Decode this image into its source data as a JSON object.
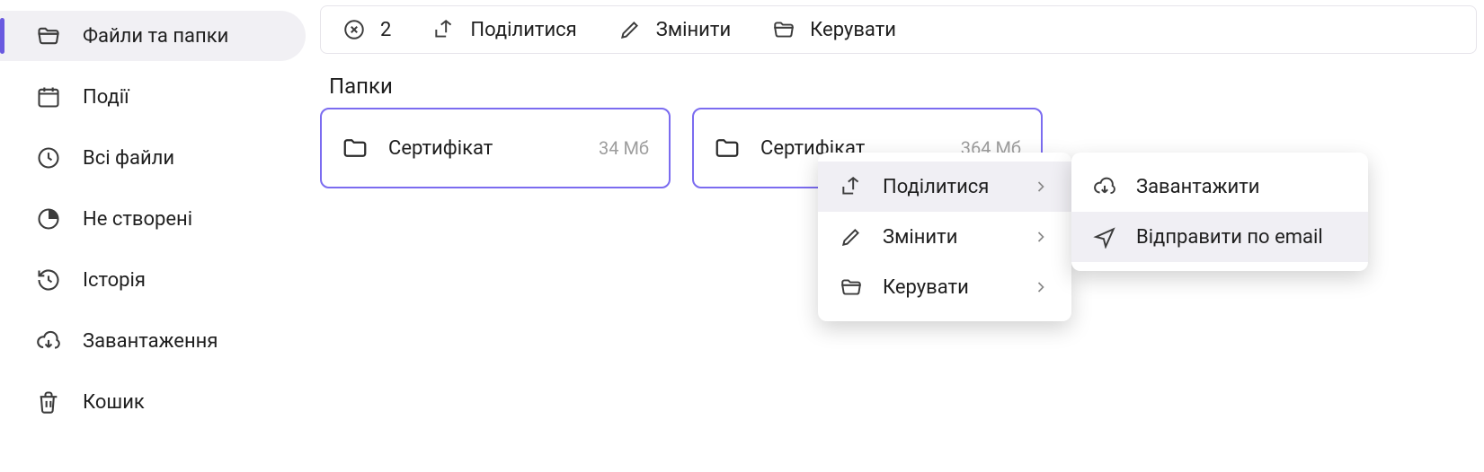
{
  "sidebar": {
    "items": [
      {
        "label": "Файли та папки",
        "icon": "folder-open"
      },
      {
        "label": "Події",
        "icon": "calendar"
      },
      {
        "label": "Всі файли",
        "icon": "clock"
      },
      {
        "label": "Не створені",
        "icon": "progress"
      },
      {
        "label": "Історія",
        "icon": "history"
      },
      {
        "label": "Завантаження",
        "icon": "download-cloud"
      },
      {
        "label": "Кошик",
        "icon": "trash"
      }
    ]
  },
  "toolbar": {
    "count": "2",
    "share": "Поділитися",
    "edit": "Змінити",
    "manage": "Керувати"
  },
  "section_title": "Папки",
  "folders": [
    {
      "name": "Сертифікат",
      "size": "34 Мб"
    },
    {
      "name": "Сертифікат",
      "size": "364 Мб"
    }
  ],
  "context_menu": {
    "share": "Поділитися",
    "edit": "Змінити",
    "manage": "Керувати"
  },
  "submenu": {
    "download": "Завантажити",
    "email": "Відправити по email"
  }
}
